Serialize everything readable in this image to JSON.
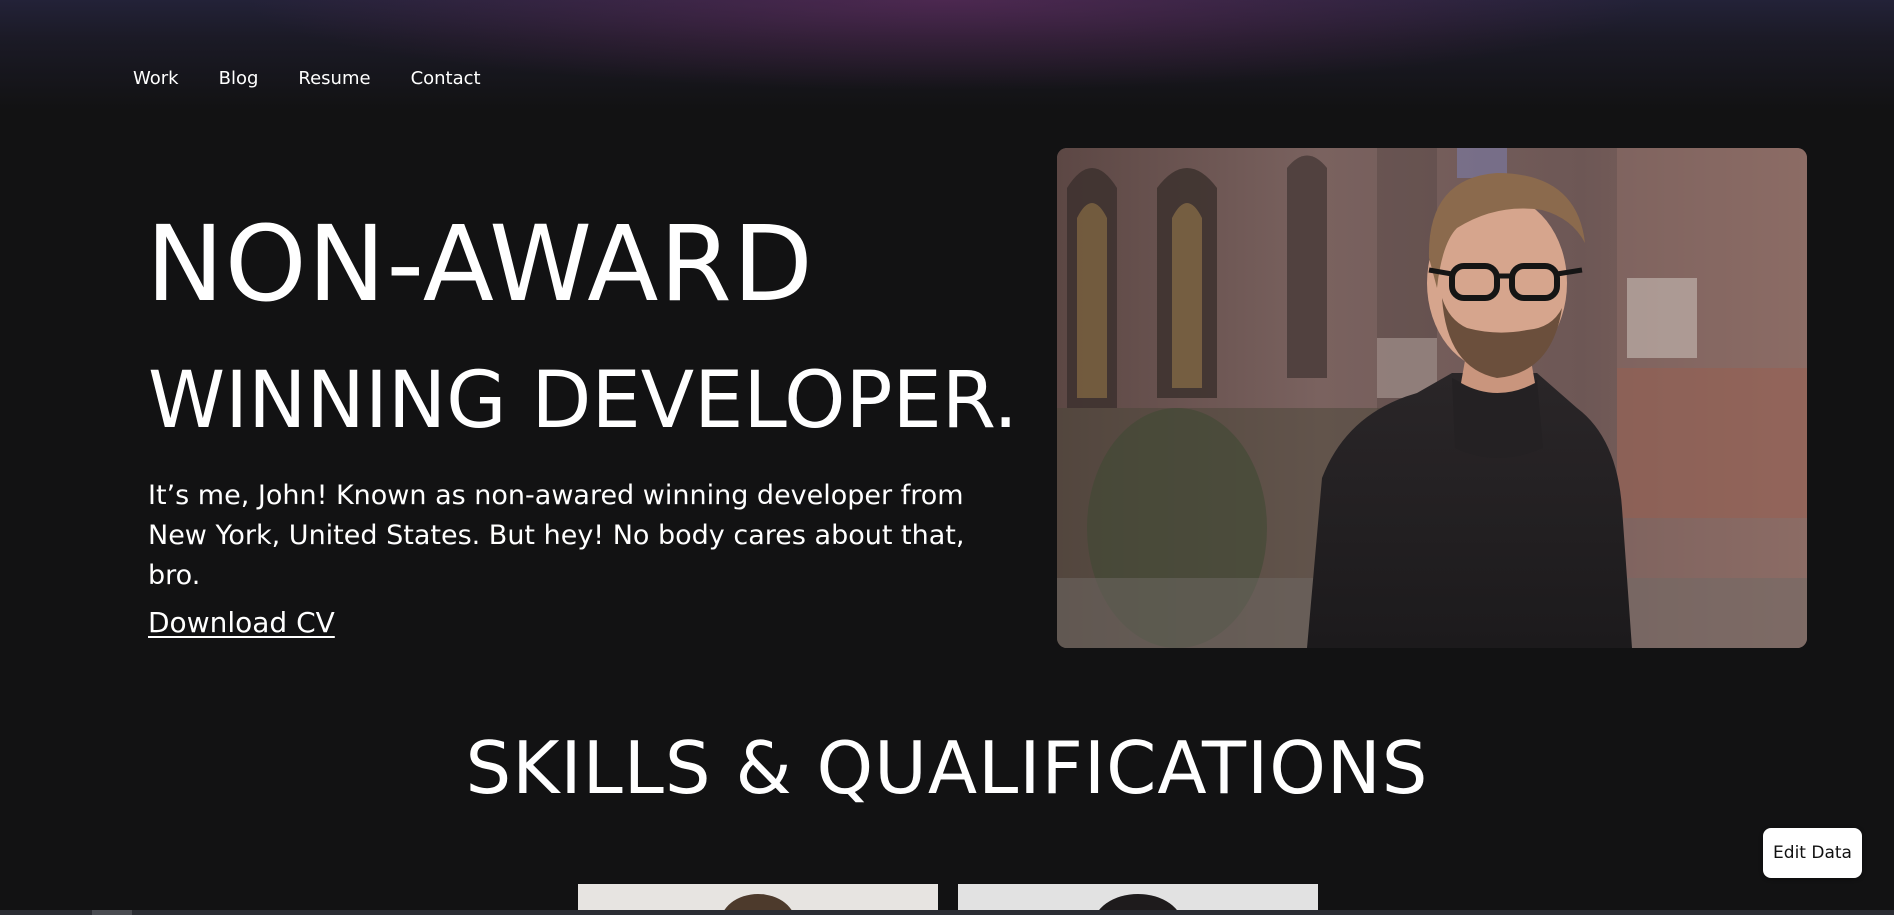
{
  "nav": {
    "items": [
      {
        "label": "Work"
      },
      {
        "label": "Blog"
      },
      {
        "label": "Resume"
      },
      {
        "label": "Contact"
      }
    ]
  },
  "hero": {
    "title_line1": "NON-AWARD",
    "title_line2": "WINNING DEVELOPER.",
    "intro": "It’s me, John! Known as non-awared winning developer from New York, United States. But hey! No body cares about that, bro.",
    "download_label": "Download CV"
  },
  "skills": {
    "title": "SKILLS & QUALIFICATIONS"
  },
  "edit_button": {
    "label": "Edit Data"
  },
  "colors": {
    "background": "#121213",
    "text": "#ffffff",
    "button_bg": "#ffffff"
  }
}
